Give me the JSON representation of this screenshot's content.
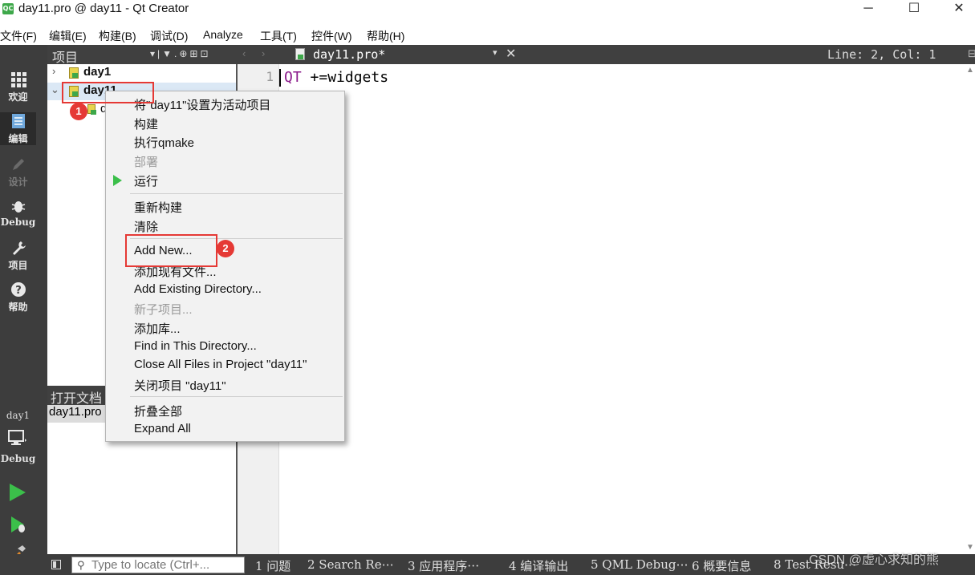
{
  "window": {
    "app_icon_text": "QC",
    "title": "day11.pro @ day11 - Qt Creator",
    "minimize": "─",
    "maximize": "☐",
    "close": "✕"
  },
  "menubar": [
    "文件(F)",
    "编辑(E)",
    "构建(B)",
    "调试(D)",
    "Analyze",
    "工具(T)",
    "控件(W)",
    "帮助(H)"
  ],
  "modes": [
    {
      "label": "欢迎",
      "icon": "grid-icon"
    },
    {
      "label": "编辑",
      "icon": "document-icon"
    },
    {
      "label": "设计",
      "icon": "pencil-icon"
    },
    {
      "label": "Debug",
      "icon": "bug-icon"
    },
    {
      "label": "项目",
      "icon": "wrench-icon"
    },
    {
      "label": "帮助",
      "icon": "help-icon"
    }
  ],
  "kit": {
    "name": "day1",
    "mode": "Debug"
  },
  "project_panel": {
    "title": "项目",
    "tools": "▾|▼.⊕⊞⊡",
    "tree": [
      {
        "label": "day1",
        "expanded": false
      },
      {
        "label": "day11",
        "expanded": true
      },
      {
        "label": "d"
      }
    ]
  },
  "open_documents": {
    "title": "打开文档",
    "items": [
      "day11.pro"
    ]
  },
  "editor": {
    "nav": "‹ ›",
    "document": "day11.pro*",
    "dropdown": "▾",
    "close": "✕",
    "position": "Line: 2, Col: 1",
    "split": "⊟",
    "line_numbers": [
      "1"
    ],
    "code": {
      "keyword": "QT",
      "rest": " +=widgets"
    }
  },
  "context_menu": {
    "items": [
      {
        "label": "将\"day11\"设置为活动项目",
        "disabled": false
      },
      {
        "label": "构建",
        "disabled": false
      },
      {
        "label": "执行qmake",
        "disabled": false
      },
      {
        "label": "部署",
        "disabled": true
      },
      {
        "label": "运行",
        "disabled": false
      },
      {
        "label": "重新构建",
        "disabled": false
      },
      {
        "label": "清除",
        "disabled": false
      },
      {
        "label": "Add New...",
        "disabled": false
      },
      {
        "label": "添加现有文件...",
        "disabled": false
      },
      {
        "label": "Add Existing Directory...",
        "disabled": false
      },
      {
        "label": "新子项目...",
        "disabled": true
      },
      {
        "label": "添加库...",
        "disabled": false
      },
      {
        "label": "Find in This Directory...",
        "disabled": false
      },
      {
        "label": "Close All Files in Project \"day11\"",
        "disabled": false
      },
      {
        "label": "关闭项目 \"day11\"",
        "disabled": false
      },
      {
        "label": "折叠全部",
        "disabled": false
      },
      {
        "label": "Expand All",
        "disabled": false
      }
    ]
  },
  "statusbar": {
    "locator_placeholder": "Type to locate (Ctrl+...",
    "output_tabs": [
      "1 问题",
      "2 Search Re⋯",
      "3 应用程序⋯",
      "4 编译输出",
      "5 QML Debug⋯",
      "6 概要信息",
      "8 Test Resu⋯"
    ]
  },
  "annotations": {
    "badge1": "1",
    "badge2": "2"
  },
  "watermark": "CSDN @虚心求知的熊",
  "colors": {
    "annotation": "#e53935",
    "run_green": "#3bbf4a",
    "sidebar": "#3d3d3d"
  }
}
